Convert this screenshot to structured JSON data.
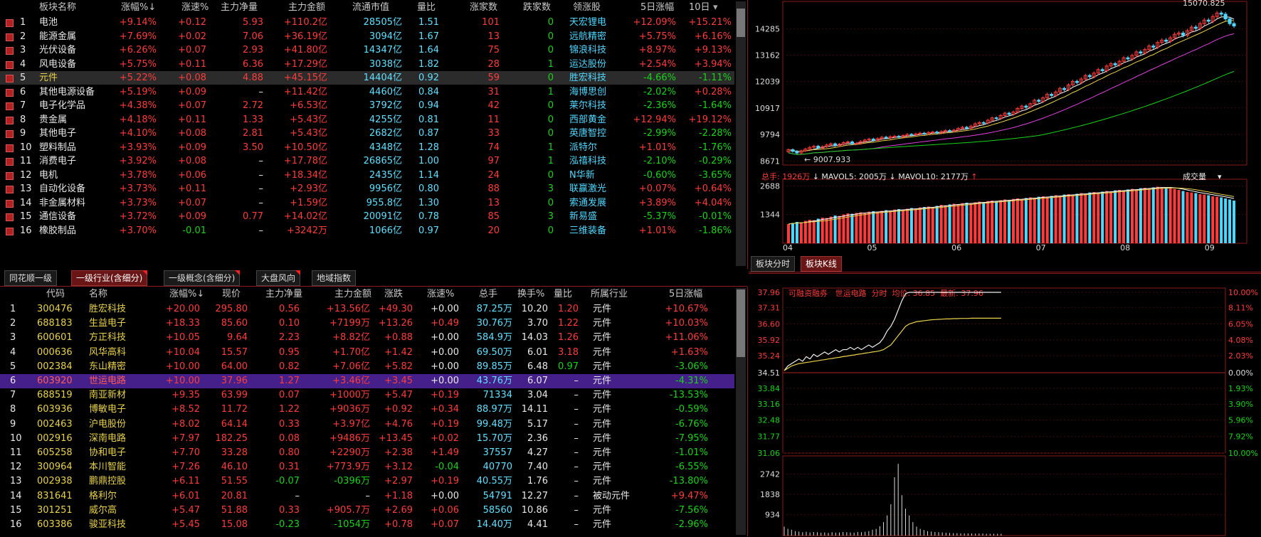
{
  "sector_table": {
    "headers": [
      "板块名称",
      "涨幅%↓",
      "涨速%",
      "主力净量",
      "主力金额",
      "流通市值",
      "量比",
      "涨家数",
      "跌家数",
      "领涨股",
      "5日涨幅",
      "10日"
    ],
    "rows": [
      {
        "idx": "1",
        "name": "电池",
        "chg": "+9.14%",
        "speed": "+0.12",
        "netvol": "5.93",
        "amount": "+110.2亿",
        "cap": "28505亿",
        "ratio": "1.51",
        "up": "101",
        "down": "0",
        "leader": "天宏锂电",
        "d5": "+12.09%",
        "d10": "+15.21%"
      },
      {
        "idx": "2",
        "name": "能源金属",
        "chg": "+7.69%",
        "speed": "+0.02",
        "netvol": "7.06",
        "amount": "+36.19亿",
        "cap": "3094亿",
        "ratio": "1.67",
        "up": "13",
        "down": "0",
        "leader": "远航精密",
        "d5": "+5.75%",
        "d10": "+6.16%"
      },
      {
        "idx": "3",
        "name": "光伏设备",
        "chg": "+6.26%",
        "speed": "+0.07",
        "netvol": "2.93",
        "amount": "+41.80亿",
        "cap": "14347亿",
        "ratio": "1.64",
        "up": "75",
        "down": "0",
        "leader": "锦浪科技",
        "d5": "+8.97%",
        "d10": "+9.13%"
      },
      {
        "idx": "4",
        "name": "风电设备",
        "chg": "+5.75%",
        "speed": "+0.11",
        "netvol": "6.36",
        "amount": "+17.29亿",
        "cap": "3038亿",
        "ratio": "1.82",
        "up": "28",
        "down": "1",
        "leader": "运达股份",
        "d5": "+2.54%",
        "d10": "+3.94%"
      },
      {
        "idx": "5",
        "name": "元件",
        "chg": "+5.22%",
        "speed": "+0.08",
        "netvol": "4.88",
        "amount": "+45.15亿",
        "cap": "14404亿",
        "ratio": "0.92",
        "up": "59",
        "down": "0",
        "leader": "胜宏科技",
        "d5": "-4.66%",
        "d10": "-1.11%"
      },
      {
        "idx": "6",
        "name": "其他电源设备",
        "chg": "+5.19%",
        "speed": "+0.09",
        "netvol": "–",
        "amount": "+11.42亿",
        "cap": "4460亿",
        "ratio": "0.84",
        "up": "31",
        "down": "1",
        "leader": "海博思创",
        "d5": "-2.02%",
        "d10": "+0.28%"
      },
      {
        "idx": "7",
        "name": "电子化学品",
        "chg": "+4.38%",
        "speed": "+0.07",
        "netvol": "2.72",
        "amount": "+6.53亿",
        "cap": "3792亿",
        "ratio": "0.94",
        "up": "42",
        "down": "0",
        "leader": "莱尔科技",
        "d5": "-2.36%",
        "d10": "-1.64%"
      },
      {
        "idx": "8",
        "name": "贵金属",
        "chg": "+4.18%",
        "speed": "+0.11",
        "netvol": "1.33",
        "amount": "+5.43亿",
        "cap": "4255亿",
        "ratio": "0.81",
        "up": "11",
        "down": "0",
        "leader": "西部黄金",
        "d5": "+12.94%",
        "d10": "+19.12%"
      },
      {
        "idx": "9",
        "name": "其他电子",
        "chg": "+4.10%",
        "speed": "+0.08",
        "netvol": "2.81",
        "amount": "+5.43亿",
        "cap": "2682亿",
        "ratio": "0.87",
        "up": "33",
        "down": "0",
        "leader": "英唐智控",
        "d5": "-2.99%",
        "d10": "-2.28%"
      },
      {
        "idx": "10",
        "name": "塑料制品",
        "chg": "+3.93%",
        "speed": "+0.09",
        "netvol": "3.50",
        "amount": "+10.50亿",
        "cap": "4348亿",
        "ratio": "1.28",
        "up": "74",
        "down": "1",
        "leader": "派特尔",
        "d5": "+1.01%",
        "d10": "-1.76%"
      },
      {
        "idx": "11",
        "name": "消费电子",
        "chg": "+3.92%",
        "speed": "+0.08",
        "netvol": "–",
        "amount": "+17.78亿",
        "cap": "26865亿",
        "ratio": "1.00",
        "up": "97",
        "down": "1",
        "leader": "泓禧科技",
        "d5": "-2.10%",
        "d10": "-0.29%"
      },
      {
        "idx": "12",
        "name": "电机",
        "chg": "+3.78%",
        "speed": "+0.06",
        "netvol": "–",
        "amount": "+18.34亿",
        "cap": "2435亿",
        "ratio": "1.14",
        "up": "24",
        "down": "0",
        "leader": "N华新",
        "d5": "-0.60%",
        "d10": "-3.65%"
      },
      {
        "idx": "13",
        "name": "自动化设备",
        "chg": "+3.73%",
        "speed": "+0.11",
        "netvol": "–",
        "amount": "+2.93亿",
        "cap": "9956亿",
        "ratio": "0.80",
        "up": "88",
        "down": "3",
        "leader": "联赢激光",
        "d5": "+0.07%",
        "d10": "+0.64%"
      },
      {
        "idx": "14",
        "name": "非金属材料",
        "chg": "+3.73%",
        "speed": "+0.07",
        "netvol": "–",
        "amount": "+1.59亿",
        "cap": "955.8亿",
        "ratio": "1.30",
        "up": "13",
        "down": "0",
        "leader": "索通发展",
        "d5": "+3.89%",
        "d10": "+4.04%"
      },
      {
        "idx": "15",
        "name": "通信设备",
        "chg": "+3.72%",
        "speed": "+0.09",
        "netvol": "0.77",
        "amount": "+14.02亿",
        "cap": "20091亿",
        "ratio": "0.78",
        "up": "85",
        "down": "3",
        "leader": "新易盛",
        "d5": "-5.37%",
        "d10": "-0.01%"
      },
      {
        "idx": "16",
        "name": "橡胶制品",
        "chg": "+3.70%",
        "speed": "-0.01",
        "netvol": "–",
        "amount": "+3242万",
        "cap": "1066亿",
        "ratio": "0.97",
        "up": "20",
        "down": "0",
        "leader": "三维装备",
        "d5": "+1.01%",
        "d10": "-1.86%"
      }
    ]
  },
  "tabs": [
    "同花顺一级",
    "一级行业(含细分)",
    "一级概念(含细分)",
    "大盘风向",
    "地域指数"
  ],
  "stock_table": {
    "headers": [
      "代码",
      "名称",
      "涨幅%↓",
      "现价",
      "主力净量",
      "主力金额",
      "涨跌",
      "涨速%",
      "总手",
      "换手%",
      "量比",
      "所属行业",
      "5日涨幅"
    ],
    "rows": [
      {
        "idx": "1",
        "code": "300476",
        "name": "胜宏科技",
        "chg": "+20.00",
        "price": "295.80",
        "netvol": "0.56",
        "amount": "+13.56亿",
        "diff": "+49.30",
        "speed": "+0.00",
        "vol": "87.25万",
        "turn": "10.20",
        "ratio": "1.20",
        "ind": "元件",
        "d5": "+10.67%"
      },
      {
        "idx": "2",
        "code": "688183",
        "name": "生益电子",
        "chg": "+18.33",
        "price": "85.60",
        "netvol": "0.10",
        "amount": "+7199万",
        "diff": "+13.26",
        "speed": "+0.49",
        "vol": "30.76万",
        "turn": "3.70",
        "ratio": "1.22",
        "ind": "元件",
        "d5": "+10.03%"
      },
      {
        "idx": "3",
        "code": "600601",
        "name": "方正科技",
        "chg": "+10.05",
        "price": "9.64",
        "netvol": "2.23",
        "amount": "+8.82亿",
        "diff": "+0.88",
        "speed": "+0.00",
        "vol": "584.9万",
        "turn": "14.03",
        "ratio": "1.26",
        "ind": "元件",
        "d5": "+11.06%"
      },
      {
        "idx": "4",
        "code": "000636",
        "name": "风华高科",
        "chg": "+10.04",
        "price": "15.57",
        "netvol": "0.95",
        "amount": "+1.70亿",
        "diff": "+1.42",
        "speed": "+0.00",
        "vol": "69.50万",
        "turn": "6.01",
        "ratio": "3.18",
        "ind": "元件",
        "d5": "+1.63%"
      },
      {
        "idx": "5",
        "code": "002384",
        "name": "东山精密",
        "chg": "+10.00",
        "price": "64.00",
        "netvol": "0.82",
        "amount": "+7.06亿",
        "diff": "+5.82",
        "speed": "+0.00",
        "vol": "89.85万",
        "turn": "6.48",
        "ratio": "0.97",
        "ind": "元件",
        "d5": "-3.06%"
      },
      {
        "idx": "6",
        "code": "603920",
        "name": "世运电路",
        "chg": "+10.00",
        "price": "37.96",
        "netvol": "1.27",
        "amount": "+3.46亿",
        "diff": "+3.45",
        "speed": "+0.00",
        "vol": "43.76万",
        "turn": "6.07",
        "ratio": "–",
        "ind": "元件",
        "d5": "-4.31%"
      },
      {
        "idx": "7",
        "code": "688519",
        "name": "南亚新材",
        "chg": "+9.35",
        "price": "63.99",
        "netvol": "0.07",
        "amount": "+1000万",
        "diff": "+5.47",
        "speed": "+0.19",
        "vol": "71334",
        "turn": "3.04",
        "ratio": "–",
        "ind": "元件",
        "d5": "-13.53%"
      },
      {
        "idx": "8",
        "code": "603936",
        "name": "博敏电子",
        "chg": "+8.52",
        "price": "11.72",
        "netvol": "1.22",
        "amount": "+9036万",
        "diff": "+0.92",
        "speed": "+0.34",
        "vol": "88.97万",
        "turn": "14.11",
        "ratio": "–",
        "ind": "元件",
        "d5": "-0.59%"
      },
      {
        "idx": "9",
        "code": "002463",
        "name": "沪电股份",
        "chg": "+8.02",
        "price": "64.14",
        "netvol": "0.33",
        "amount": "+3.97亿",
        "diff": "+4.76",
        "speed": "+0.19",
        "vol": "99.48万",
        "turn": "5.17",
        "ratio": "–",
        "ind": "元件",
        "d5": "-6.76%"
      },
      {
        "idx": "10",
        "code": "002916",
        "name": "深南电路",
        "chg": "+7.97",
        "price": "182.25",
        "netvol": "0.08",
        "amount": "+9486万",
        "diff": "+13.45",
        "speed": "+0.02",
        "vol": "15.70万",
        "turn": "2.36",
        "ratio": "–",
        "ind": "元件",
        "d5": "-7.95%"
      },
      {
        "idx": "11",
        "code": "605258",
        "name": "协和电子",
        "chg": "+7.70",
        "price": "33.28",
        "netvol": "0.80",
        "amount": "+2290万",
        "diff": "+2.38",
        "speed": "+1.49",
        "vol": "37557",
        "turn": "4.27",
        "ratio": "–",
        "ind": "元件",
        "d5": "-1.01%"
      },
      {
        "idx": "12",
        "code": "300964",
        "name": "本川智能",
        "chg": "+7.26",
        "price": "46.10",
        "netvol": "0.31",
        "amount": "+773.9万",
        "diff": "+3.12",
        "speed": "-0.04",
        "vol": "40770",
        "turn": "7.40",
        "ratio": "–",
        "ind": "元件",
        "d5": "-6.55%"
      },
      {
        "idx": "13",
        "code": "002938",
        "name": "鹏鼎控股",
        "chg": "+6.11",
        "price": "51.55",
        "netvol": "-0.07",
        "amount": "-0396万",
        "diff": "+2.97",
        "speed": "+0.19",
        "vol": "40.55万",
        "turn": "1.76",
        "ratio": "–",
        "ind": "元件",
        "d5": "-13.80%"
      },
      {
        "idx": "14",
        "code": "831641",
        "name": "格利尔",
        "chg": "+6.01",
        "price": "20.81",
        "netvol": "–",
        "amount": "–",
        "diff": "+1.18",
        "speed": "+0.00",
        "vol": "54791",
        "turn": "12.27",
        "ratio": "–",
        "ind": "被动元件",
        "d5": "+9.47%"
      },
      {
        "idx": "15",
        "code": "301251",
        "name": "威尔高",
        "chg": "+5.47",
        "price": "51.88",
        "netvol": "0.33",
        "amount": "+905.7万",
        "diff": "+2.69",
        "speed": "+0.06",
        "vol": "58560",
        "turn": "10.86",
        "ratio": "–",
        "ind": "元件",
        "d5": "-7.56%"
      },
      {
        "idx": "16",
        "code": "603386",
        "name": "骏亚科技",
        "chg": "+5.45",
        "price": "15.08",
        "netvol": "-0.23",
        "amount": "-1054万",
        "diff": "+0.78",
        "speed": "+0.07",
        "vol": "14.40万",
        "turn": "4.41",
        "ratio": "–",
        "ind": "元件",
        "d5": "-2.96%"
      }
    ]
  },
  "kline": {
    "price_ticks": [
      "14285",
      "13162",
      "12039",
      "10917",
      "9794",
      "8671"
    ],
    "high_label": "15070.825",
    "low_label": "9007.933",
    "vol_info": {
      "total": "总手: 1926万",
      "mavol5": "MAVOL5: 2005万",
      "mavol10": "MAVOL10: 2177万"
    },
    "vol_menu": "成交量",
    "vol_ticks": [
      "2688",
      "1344"
    ],
    "date_ticks": [
      "04",
      "05",
      "06",
      "07",
      "08",
      "09"
    ],
    "closes": [
      9150,
      9080,
      9010,
      9100,
      9180,
      9250,
      9300,
      9220,
      9280,
      9350,
      9400,
      9330,
      9380,
      9450,
      9480,
      9400,
      9420,
      9500,
      9560,
      9600,
      9550,
      9620,
      9680,
      9650,
      9700,
      9720,
      9680,
      9750,
      9800,
      9780,
      9820,
      9850,
      9830,
      9880,
      9900,
      9860,
      9920,
      9960,
      9940,
      9980,
      10050,
      10100,
      10060,
      10150,
      10250,
      10300,
      10280,
      10400,
      10500,
      10480,
      10600,
      10700,
      10650,
      10750,
      10900,
      11000,
      10950,
      11100,
      11250,
      11200,
      11350,
      11500,
      11450,
      11600,
      11750,
      11700,
      11900,
      12050,
      12000,
      12150,
      12300,
      12250,
      12400,
      12550,
      12500,
      12700,
      12800,
      12750,
      12900,
      13050,
      13000,
      13150,
      13300,
      13250,
      13400,
      13550,
      13500,
      13700,
      13800,
      13750,
      13900,
      14050,
      14100,
      14000,
      14200,
      14350,
      14300,
      14500,
      14650,
      14600,
      14800,
      14950,
      14900,
      14700,
      14500,
      14400
    ],
    "volumes": [
      900,
      950,
      1000,
      980,
      1050,
      1100,
      1080,
      1150,
      1200,
      1180,
      1250,
      1300,
      1280,
      1350,
      1400,
      1380,
      1420,
      1450,
      1430,
      1480,
      1500,
      1470,
      1520,
      1550,
      1530,
      1580,
      1600,
      1570,
      1620,
      1650,
      1630,
      1680,
      1700,
      1720,
      1690,
      1750,
      1800,
      1780,
      1820,
      1850,
      1830,
      1880,
      1900,
      1870,
      1920,
      1950,
      1930,
      1980,
      2000,
      1970,
      2020,
      2050,
      2030,
      2080,
      2100,
      2060,
      2120,
      2150,
      2130,
      2180,
      2200,
      2170,
      2220,
      2250,
      2230,
      2280,
      2300,
      2270,
      2320,
      2350,
      2330,
      2380,
      2400,
      2370,
      2420,
      2450,
      2430,
      2480,
      2500,
      2470,
      2520,
      2550,
      2530,
      2580,
      2600,
      2570,
      2620,
      2650,
      2630,
      2600,
      2580,
      2550,
      2500,
      2450,
      2400,
      2380,
      2350,
      2300,
      2280,
      2250,
      2200,
      2180,
      2150,
      2100,
      2050,
      2000
    ]
  },
  "kline_tabs": [
    "板块分时",
    "板块K线"
  ],
  "intraday": {
    "header": "可融资融券   世运电路  分时  均价: 36.85  最新: 37.96",
    "left_ticks": [
      "37.96",
      "37.31",
      "36.60",
      "35.92",
      "35.24",
      "34.51",
      "33.84",
      "33.16",
      "32.48",
      "31.77",
      "31.06"
    ],
    "right_ticks": [
      "10.00%",
      "8.11%",
      "6.05%",
      "4.08%",
      "2.03%",
      "0.00%",
      "1.93%",
      "3.90%",
      "5.96%",
      "7.92%",
      "10.00%"
    ],
    "vol_ticks": [
      "2742",
      "1838",
      "934"
    ],
    "prices": [
      34.6,
      34.8,
      34.9,
      35.0,
      35.1,
      35.0,
      35.2,
      35.1,
      35.3,
      35.2,
      35.3,
      35.4,
      35.3,
      35.4,
      35.5,
      35.4,
      35.5,
      35.5,
      35.6,
      35.5,
      35.6,
      35.5,
      35.6,
      35.7,
      35.6,
      35.7,
      35.8,
      36.0,
      36.3,
      36.5,
      36.8,
      37.2,
      37.6,
      37.9,
      37.96,
      37.96,
      37.96,
      37.96,
      37.96,
      37.96,
      37.96,
      37.96,
      37.96,
      37.96,
      37.96,
      37.96,
      37.96,
      37.96,
      37.96,
      37.96,
      37.96,
      37.96,
      37.96,
      37.96,
      37.96,
      37.96,
      37.96,
      37.96,
      37.96,
      37.96
    ],
    "avg": [
      34.6,
      34.7,
      34.8,
      34.85,
      34.9,
      34.92,
      34.95,
      34.97,
      35.0,
      35.02,
      35.05,
      35.07,
      35.1,
      35.12,
      35.15,
      35.17,
      35.2,
      35.22,
      35.25,
      35.27,
      35.3,
      35.32,
      35.35,
      35.37,
      35.4,
      35.42,
      35.45,
      35.5,
      35.6,
      35.7,
      35.9,
      36.1,
      36.3,
      36.5,
      36.6,
      36.65,
      36.7,
      36.72,
      36.74,
      36.76,
      36.78,
      36.79,
      36.8,
      36.81,
      36.82,
      36.82,
      36.83,
      36.83,
      36.84,
      36.84,
      36.84,
      36.85,
      36.85,
      36.85,
      36.85,
      36.85,
      36.85,
      36.85,
      36.85,
      36.85
    ],
    "vols": [
      400,
      300,
      260,
      200,
      180,
      150,
      170,
      140,
      160,
      150,
      130,
      140,
      120,
      150,
      130,
      140,
      160,
      150,
      140,
      130,
      160,
      150,
      170,
      200,
      260,
      300,
      420,
      600,
      900,
      1400,
      2600,
      3200,
      1800,
      1200,
      900,
      600,
      400,
      300,
      250,
      200,
      180,
      160,
      150,
      140,
      130,
      120,
      110,
      110,
      100,
      100,
      100,
      90,
      90,
      90,
      90,
      80,
      80,
      80,
      80,
      80
    ]
  }
}
